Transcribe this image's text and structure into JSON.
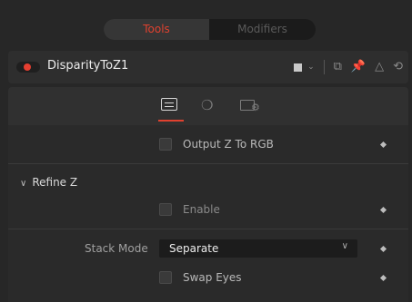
{
  "tabs": {
    "tools": "Tools",
    "modifiers": "Modifiers"
  },
  "node": {
    "title": "DisparityToZ1",
    "toggle_color": "#e63f31"
  },
  "header_icons": [
    "color-swatch-icon",
    "chevron-down-icon",
    "versions-icon",
    "pin-icon",
    "lock-icon",
    "reset-icon"
  ],
  "subtabs": [
    "controls-icon",
    "3d-icon",
    "settings-icon"
  ],
  "controls": {
    "output_z_to_rgb": "Output Z To RGB",
    "refine_z_section": "Refine Z",
    "enable": "Enable",
    "stack_mode_label": "Stack Mode",
    "stack_mode_value": "Separate",
    "swap_eyes": "Swap Eyes"
  },
  "accent": "#e0412f"
}
